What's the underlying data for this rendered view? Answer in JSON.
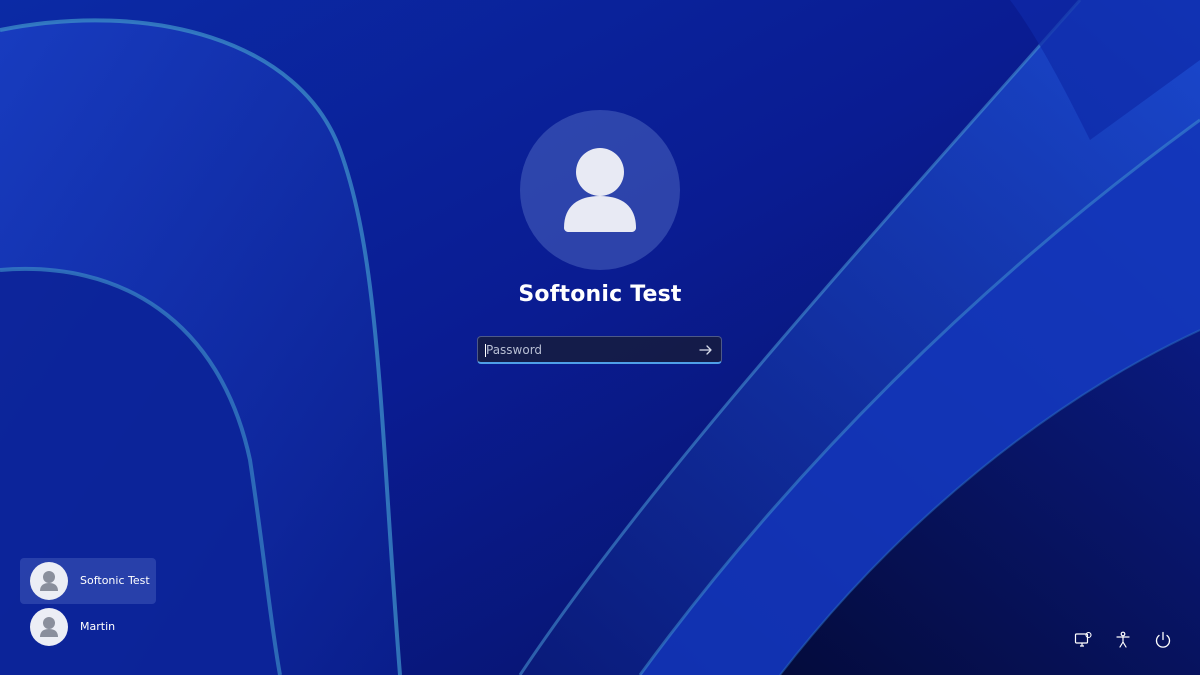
{
  "login": {
    "user_name": "Softonic Test",
    "password_placeholder": "Password",
    "password_value": ""
  },
  "users": [
    {
      "name": "Softonic Test",
      "selected": true
    },
    {
      "name": "Martin",
      "selected": false
    }
  ],
  "tray": {
    "icons": [
      "network-icon",
      "accessibility-icon",
      "power-icon"
    ]
  },
  "colors": {
    "background": "#0a1a8a",
    "accent": "#4f9fe8"
  }
}
